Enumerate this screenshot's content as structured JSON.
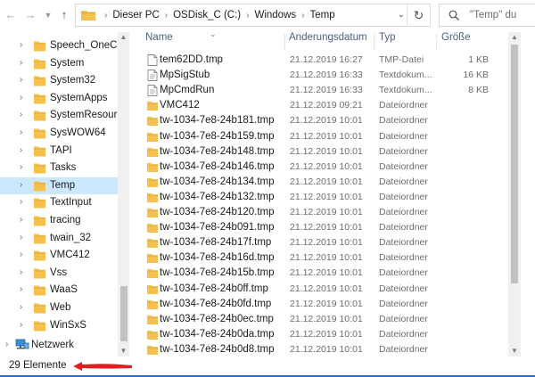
{
  "colors": {
    "folder": "#f5c14e",
    "folder_dark": "#dea73b",
    "selection": "#cce8ff",
    "header_text": "#4c607a",
    "annotation_arrow": "#e02020",
    "accent_line": "#1a6fc9"
  },
  "toolbar": {
    "back_icon": "arrow-left-icon",
    "forward_icon": "arrow-right-icon",
    "recent_icon": "chevron-down-icon",
    "up_icon": "arrow-up-icon"
  },
  "address": {
    "crumbs": [
      "Dieser PC",
      "OSDisk_C (C:)",
      "Windows",
      "Temp"
    ],
    "dropdown_icon": "chevron-down-icon",
    "refresh_icon": "refresh-icon"
  },
  "search": {
    "placeholder": "\"Temp\" du"
  },
  "nav": {
    "items": [
      {
        "label": "Speech_OneCore",
        "selected": false
      },
      {
        "label": "System",
        "selected": false
      },
      {
        "label": "System32",
        "selected": false
      },
      {
        "label": "SystemApps",
        "selected": false
      },
      {
        "label": "SystemResources",
        "selected": false
      },
      {
        "label": "SysWOW64",
        "selected": false
      },
      {
        "label": "TAPI",
        "selected": false
      },
      {
        "label": "Tasks",
        "selected": false
      },
      {
        "label": "Temp",
        "selected": true
      },
      {
        "label": "TextInput",
        "selected": false
      },
      {
        "label": "tracing",
        "selected": false
      },
      {
        "label": "twain_32",
        "selected": false
      },
      {
        "label": "VMC412",
        "selected": false
      },
      {
        "label": "Vss",
        "selected": false
      },
      {
        "label": "WaaS",
        "selected": false
      },
      {
        "label": "Web",
        "selected": false
      },
      {
        "label": "WinSxS",
        "selected": false
      }
    ],
    "network": "Netzwerk"
  },
  "columns": {
    "name": "Name",
    "date": "Änderungsdatum",
    "type": "Typ",
    "size": "Größe"
  },
  "files": [
    {
      "name": "tem62DD.tmp",
      "date": "21.12.2019 16:27",
      "type": "TMP-Datei",
      "size": "1 KB",
      "kind": "file"
    },
    {
      "name": "MpSigStub",
      "date": "21.12.2019 16:33",
      "type": "Textdokum...",
      "size": "16 KB",
      "kind": "doc"
    },
    {
      "name": "MpCmdRun",
      "date": "21.12.2019 16:33",
      "type": "Textdokum...",
      "size": "8 KB",
      "kind": "doc"
    },
    {
      "name": "VMC412",
      "date": "21.12.2019 09:21",
      "type": "Dateiordner",
      "size": "",
      "kind": "folder"
    },
    {
      "name": "tw-1034-7e8-24b181.tmp",
      "date": "21.12.2019 10:01",
      "type": "Dateiordner",
      "size": "",
      "kind": "folder"
    },
    {
      "name": "tw-1034-7e8-24b159.tmp",
      "date": "21.12.2019 10:01",
      "type": "Dateiordner",
      "size": "",
      "kind": "folder"
    },
    {
      "name": "tw-1034-7e8-24b148.tmp",
      "date": "21.12.2019 10:01",
      "type": "Dateiordner",
      "size": "",
      "kind": "folder"
    },
    {
      "name": "tw-1034-7e8-24b146.tmp",
      "date": "21.12.2019 10:01",
      "type": "Dateiordner",
      "size": "",
      "kind": "folder"
    },
    {
      "name": "tw-1034-7e8-24b134.tmp",
      "date": "21.12.2019 10:01",
      "type": "Dateiordner",
      "size": "",
      "kind": "folder"
    },
    {
      "name": "tw-1034-7e8-24b132.tmp",
      "date": "21.12.2019 10:01",
      "type": "Dateiordner",
      "size": "",
      "kind": "folder"
    },
    {
      "name": "tw-1034-7e8-24b120.tmp",
      "date": "21.12.2019 10:01",
      "type": "Dateiordner",
      "size": "",
      "kind": "folder"
    },
    {
      "name": "tw-1034-7e8-24b091.tmp",
      "date": "21.12.2019 10:01",
      "type": "Dateiordner",
      "size": "",
      "kind": "folder"
    },
    {
      "name": "tw-1034-7e8-24b17f.tmp",
      "date": "21.12.2019 10:01",
      "type": "Dateiordner",
      "size": "",
      "kind": "folder"
    },
    {
      "name": "tw-1034-7e8-24b16d.tmp",
      "date": "21.12.2019 10:01",
      "type": "Dateiordner",
      "size": "",
      "kind": "folder"
    },
    {
      "name": "tw-1034-7e8-24b15b.tmp",
      "date": "21.12.2019 10:01",
      "type": "Dateiordner",
      "size": "",
      "kind": "folder"
    },
    {
      "name": "tw-1034-7e8-24b0ff.tmp",
      "date": "21.12.2019 10:01",
      "type": "Dateiordner",
      "size": "",
      "kind": "folder"
    },
    {
      "name": "tw-1034-7e8-24b0fd.tmp",
      "date": "21.12.2019 10:01",
      "type": "Dateiordner",
      "size": "",
      "kind": "folder"
    },
    {
      "name": "tw-1034-7e8-24b0ec.tmp",
      "date": "21.12.2019 10:01",
      "type": "Dateiordner",
      "size": "",
      "kind": "folder"
    },
    {
      "name": "tw-1034-7e8-24b0da.tmp",
      "date": "21.12.2019 10:01",
      "type": "Dateiordner",
      "size": "",
      "kind": "folder"
    },
    {
      "name": "tw-1034-7e8-24b0d8.tmp",
      "date": "21.12.2019 10:01",
      "type": "Dateiordner",
      "size": "",
      "kind": "folder"
    }
  ],
  "status": {
    "count": "29 Elemente"
  }
}
